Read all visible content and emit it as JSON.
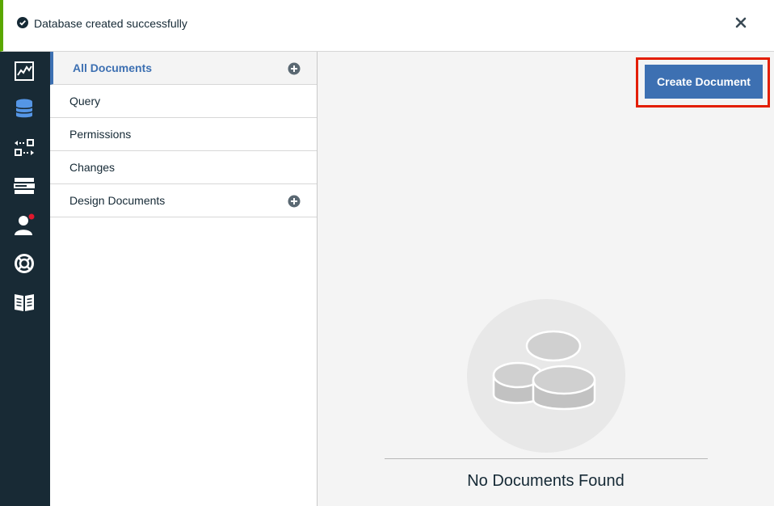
{
  "notification": {
    "message": "Database created successfully",
    "status_color": "#5aa700",
    "icons": {
      "status": "check-circle-icon",
      "close": "close-icon"
    }
  },
  "rail": {
    "items": [
      {
        "icon": "activity-chart-icon"
      },
      {
        "icon": "database-icon",
        "active": true
      },
      {
        "icon": "replication-icon"
      },
      {
        "icon": "server-config-icon"
      },
      {
        "icon": "user-icon",
        "badge": true
      },
      {
        "icon": "support-lifebuoy-icon"
      },
      {
        "icon": "documentation-book-icon"
      }
    ]
  },
  "sidebar": {
    "items": [
      {
        "label": "All Documents",
        "active": true,
        "has_add": true
      },
      {
        "label": "Query"
      },
      {
        "label": "Permissions"
      },
      {
        "label": "Changes"
      },
      {
        "label": "Design Documents",
        "has_add": true
      }
    ]
  },
  "main": {
    "create_button_label": "Create Document",
    "empty_state_text": "No Documents Found",
    "empty_icon": "empty-database-icon"
  },
  "colors": {
    "accent": "#3d70b2",
    "rail_bg": "#182a35",
    "highlight_border": "#e31e00"
  }
}
